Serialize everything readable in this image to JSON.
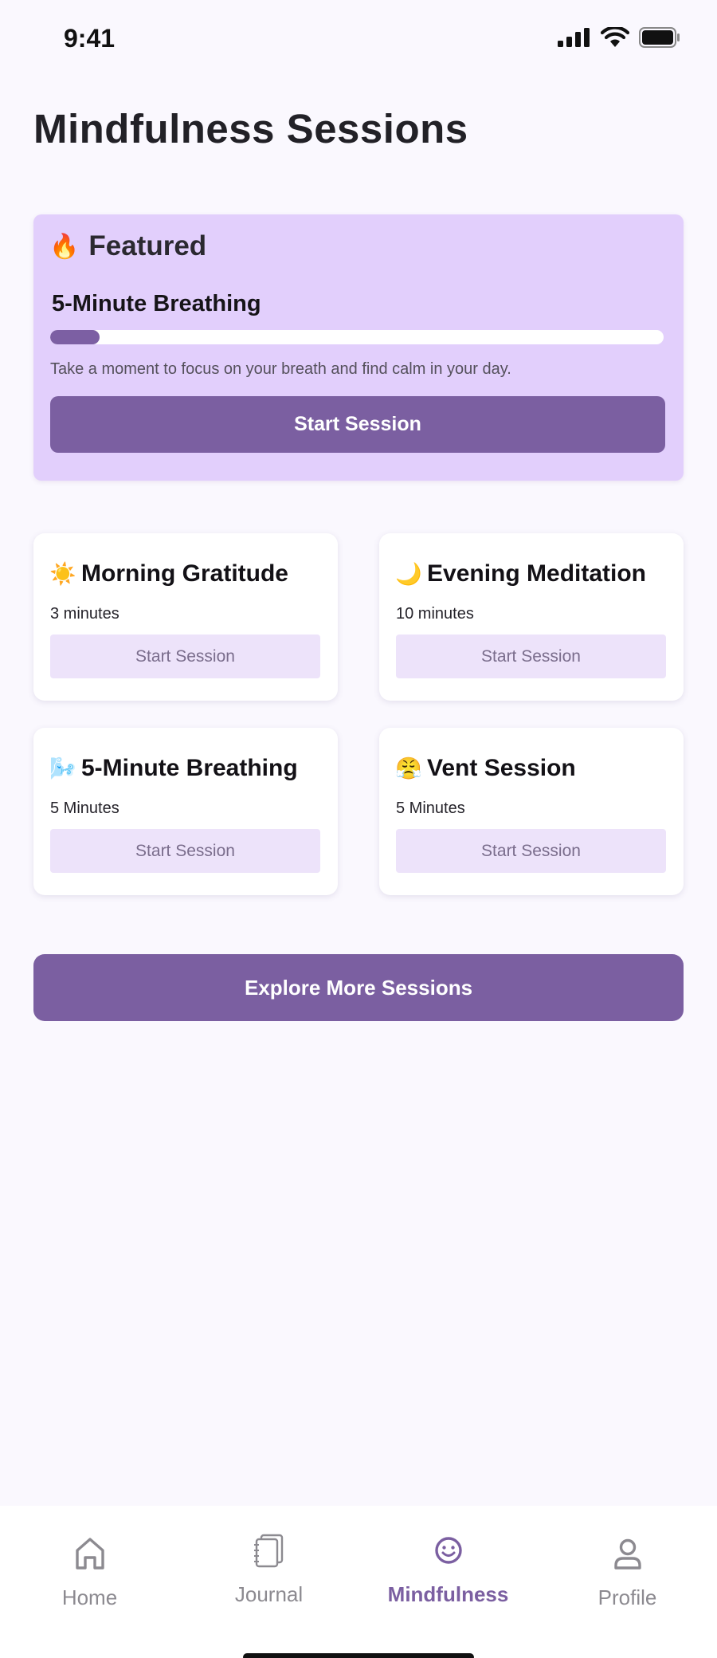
{
  "status_bar": {
    "time": "9:41"
  },
  "page": {
    "title": "Mindfulness Sessions"
  },
  "featured": {
    "emoji": "🔥",
    "label": "Featured",
    "title": "5-Minute Breathing",
    "progress": 0.08,
    "description": "Take a moment to focus on your breath and find calm in your day.",
    "button_label": "Start Session"
  },
  "sessions": [
    {
      "emoji": "☀️",
      "title": "Morning Gratitude",
      "duration": "3 minutes",
      "button_label": "Start Session"
    },
    {
      "emoji": "🌙",
      "title": "Evening Meditation",
      "duration": "10 minutes",
      "button_label": "Start Session"
    },
    {
      "emoji": "🌬️",
      "title": "5-Minute Breathing",
      "duration": "5 Minutes",
      "button_label": "Start Session"
    },
    {
      "emoji": "😤",
      "title": "Vent Session",
      "duration": "5 Minutes",
      "button_label": "Start Session"
    }
  ],
  "explore_button": "Explore More Sessions",
  "nav": {
    "items": [
      {
        "label": "Home",
        "icon": "home-icon"
      },
      {
        "label": "Journal",
        "icon": "journal-icon"
      },
      {
        "label": "Mindfulness",
        "icon": "smiley-icon",
        "active": true
      },
      {
        "label": "Profile",
        "icon": "person-icon"
      }
    ]
  },
  "colors": {
    "accent": "#7b5fa1",
    "featured_bg": "#e2cffc",
    "card_button_bg": "#ede3fa",
    "page_bg": "#faf8fe"
  }
}
